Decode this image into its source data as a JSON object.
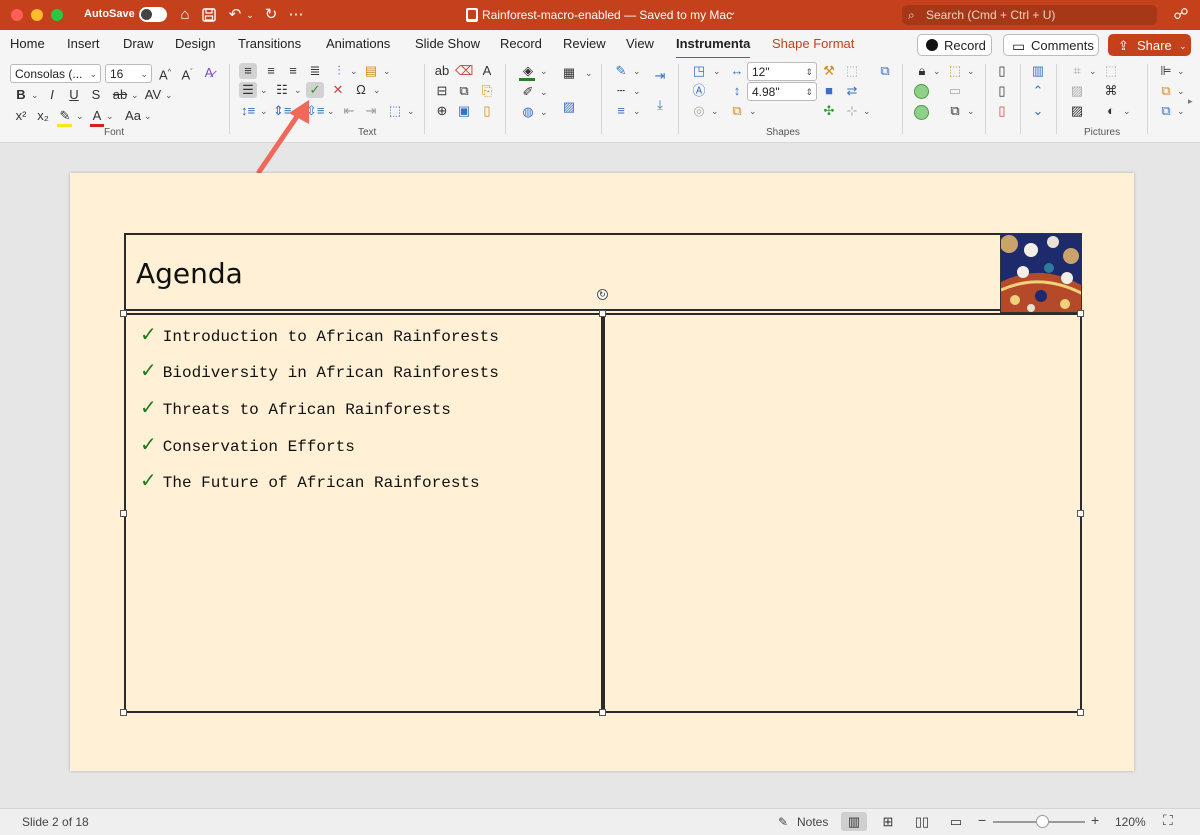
{
  "titlebar": {
    "autosave_label": "AutoSave",
    "doc_title": "Rainforest-macro-enabled — Saved to my Mac",
    "search_placeholder": "Search (Cmd + Ctrl + U)"
  },
  "tabs": [
    "Home",
    "Insert",
    "Draw",
    "Design",
    "Transitions",
    "Animations",
    "Slide Show",
    "Record",
    "Review",
    "View",
    "Instrumenta",
    "Shape Format"
  ],
  "active_tab": "Instrumenta",
  "actions": {
    "record_label": "Record",
    "comments_label": "Comments",
    "share_label": "Share"
  },
  "ribbon": {
    "font": {
      "name": "Consolas (...",
      "size": "16",
      "group_label": "Font"
    },
    "text": {
      "group_label": "Text"
    },
    "shapes": {
      "width": "12\"",
      "height": "4.98\"",
      "group_label": "Shapes"
    },
    "pictures": {
      "group_label": "Pictures"
    }
  },
  "slide": {
    "title": "Agenda",
    "items": [
      "Introduction to African Rainforests",
      "Biodiversity in African Rainforests",
      "Threats to African Rainforests",
      "Conservation Efforts",
      "The Future of African Rainforests"
    ]
  },
  "statusbar": {
    "slide_info": "Slide 2 of 18",
    "notes_label": "Notes",
    "zoom": "120%",
    "zoom_level": 0.55
  },
  "colors": {
    "accent": "#c4411c",
    "slide_background": "#fff0d6",
    "check_green": "#1e7a1e",
    "annotation_arrow": "#f0685a"
  }
}
